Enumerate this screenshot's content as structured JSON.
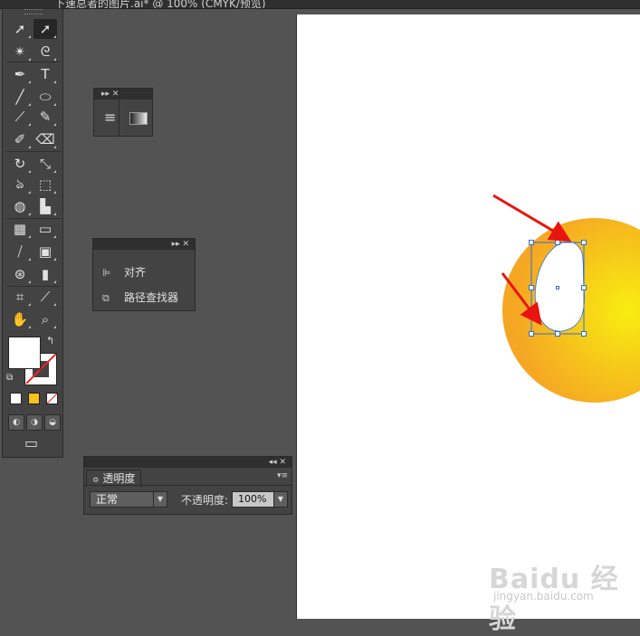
{
  "window": {
    "title": "下速总者的图片.ai* @ 100% (CMYK/预览)"
  },
  "toolbox": {
    "tools": [
      {
        "name": "selection-tool",
        "glyph": "➚"
      },
      {
        "name": "direct-selection-tool",
        "glyph": "➚"
      },
      {
        "name": "magic-wand-tool",
        "glyph": "✴"
      },
      {
        "name": "lasso-tool",
        "glyph": "ᘓ"
      },
      {
        "name": "pen-tool",
        "glyph": "✒"
      },
      {
        "name": "type-tool",
        "glyph": "T"
      },
      {
        "name": "line-tool",
        "glyph": "╱"
      },
      {
        "name": "ellipse-tool",
        "glyph": "⬭"
      },
      {
        "name": "paintbrush-tool",
        "glyph": "⟋"
      },
      {
        "name": "pencil-tool",
        "glyph": "✎"
      },
      {
        "name": "blob-brush-tool",
        "glyph": "✐"
      },
      {
        "name": "eraser-tool",
        "glyph": "⌫"
      },
      {
        "name": "rotate-tool",
        "glyph": "↻"
      },
      {
        "name": "scale-tool",
        "glyph": "⤡"
      },
      {
        "name": "warp-tool",
        "glyph": "ঌ"
      },
      {
        "name": "free-transform-tool",
        "glyph": "⬚"
      },
      {
        "name": "shape-builder-tool",
        "glyph": "◍"
      },
      {
        "name": "perspective-grid-tool",
        "glyph": "▙"
      },
      {
        "name": "mesh-tool",
        "glyph": "▦"
      },
      {
        "name": "gradient-tool",
        "glyph": "▭"
      },
      {
        "name": "eyedropper-tool",
        "glyph": "⧸"
      },
      {
        "name": "blend-tool",
        "glyph": "▣"
      },
      {
        "name": "symbol-sprayer-tool",
        "glyph": "⊛"
      },
      {
        "name": "column-graph-tool",
        "glyph": "▮"
      },
      {
        "name": "artboard-tool",
        "glyph": "⌗"
      },
      {
        "name": "slice-tool",
        "glyph": "⟋"
      },
      {
        "name": "hand-tool",
        "glyph": "✋"
      },
      {
        "name": "zoom-tool",
        "glyph": "⌕"
      }
    ],
    "swap_glyph": "↰",
    "default_glyph": "⧉",
    "screen_mode_glyph": "▭"
  },
  "mini_panel": {
    "menu_icon": "≡",
    "gradient_icon": "▤",
    "controls": "▸▸ ✕"
  },
  "align_panel": {
    "controls": "▸▸ ✕",
    "items": [
      {
        "label": "对齐",
        "icon": "align-icon",
        "glyph": "⊫"
      },
      {
        "label": "路径查找器",
        "icon": "pathfinder-icon",
        "glyph": "⧉"
      }
    ]
  },
  "transparency_panel": {
    "controls": "◂◂ ✕",
    "tab_label": "透明度",
    "tab_glyph": "≎",
    "menu_glyph": "▾≡",
    "blend_mode": "正常",
    "opacity_label": "不透明度:",
    "opacity_value": "100%",
    "dropdown_glyph": "▼"
  },
  "colors": {
    "circle_center": "#f8ee10",
    "circle_edge": "#f5a623",
    "arrow": "#e8140f",
    "selection": "#2f6fd6"
  },
  "watermark": {
    "brand": "Baidu 经验",
    "url": "jingyan.baidu.com"
  }
}
